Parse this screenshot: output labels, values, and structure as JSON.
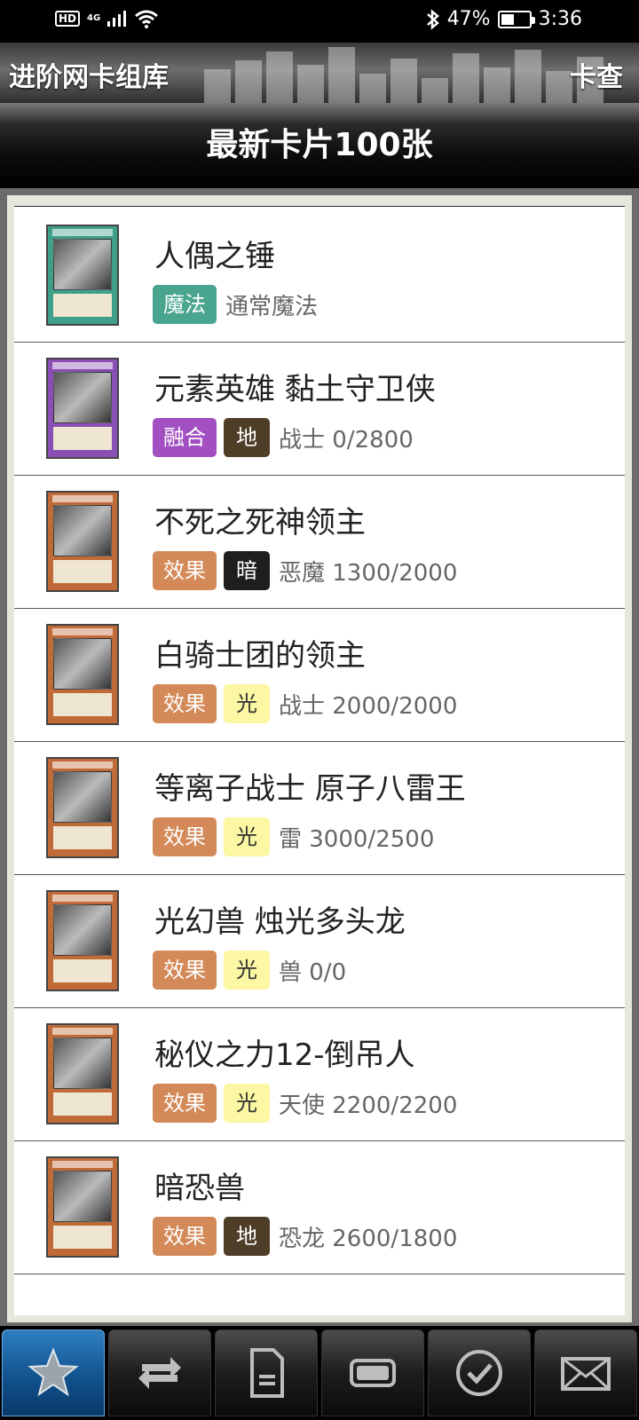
{
  "status_bar": {
    "hd": "HD",
    "network": "4G",
    "battery_percent": "47%",
    "battery_level": 0.47,
    "time": "3:36"
  },
  "header": {
    "title": "进阶网卡组库",
    "action_label": "卡查"
  },
  "section": {
    "title": "最新卡片100张"
  },
  "colors": {
    "spell": "#4aa58f",
    "fusion": "#a14fc1",
    "effect": "#d38a58",
    "attr_earth": "#4e3d27",
    "attr_dark": "#1e1e1e",
    "attr_light": "#fbf7a3",
    "nav_active": "#1f6fb2"
  },
  "cards": [
    {
      "name": "人偶之锤",
      "type": "魔法",
      "type_color": "#4aa58f",
      "attribute": "",
      "attr_bg": "",
      "attr_fg": "",
      "info": "通常魔法",
      "art": "#3fa08a"
    },
    {
      "name": "元素英雄 黏土守卫侠",
      "type": "融合",
      "type_color": "#a14fc1",
      "attribute": "地",
      "attr_bg": "#4e3d27",
      "attr_fg": "#ffffff",
      "info": "战士 0/2800",
      "art": "#8a4fb5"
    },
    {
      "name": "不死之死神领主",
      "type": "效果",
      "type_color": "#d38a58",
      "attribute": "暗",
      "attr_bg": "#1e1e1e",
      "attr_fg": "#ffffff",
      "info": "恶魔 1300/2000",
      "art": "#c06a38"
    },
    {
      "name": "白骑士团的领主",
      "type": "效果",
      "type_color": "#d38a58",
      "attribute": "光",
      "attr_bg": "#fbf7a3",
      "attr_fg": "#333333",
      "info": "战士 2000/2000",
      "art": "#c06a38"
    },
    {
      "name": "等离子战士 原子八雷王",
      "type": "效果",
      "type_color": "#d38a58",
      "attribute": "光",
      "attr_bg": "#fbf7a3",
      "attr_fg": "#333333",
      "info": "雷 3000/2500",
      "art": "#c06a38"
    },
    {
      "name": "光幻兽 烛光多头龙",
      "type": "效果",
      "type_color": "#d38a58",
      "attribute": "光",
      "attr_bg": "#fbf7a3",
      "attr_fg": "#333333",
      "info": "兽 0/0",
      "art": "#c06a38"
    },
    {
      "name": "秘仪之力12-倒吊人",
      "type": "效果",
      "type_color": "#d38a58",
      "attribute": "光",
      "attr_bg": "#fbf7a3",
      "attr_fg": "#333333",
      "info": "天使 2200/2200",
      "art": "#c06a38"
    },
    {
      "name": "暗恐兽",
      "type": "效果",
      "type_color": "#d38a58",
      "attribute": "地",
      "attr_bg": "#4e3d27",
      "attr_fg": "#ffffff",
      "info": "恐龙 2600/1800",
      "art": "#c06a38"
    }
  ],
  "bottom_nav": [
    {
      "icon": "star-icon",
      "active": true
    },
    {
      "icon": "refresh-icon",
      "active": false
    },
    {
      "icon": "document-icon",
      "active": false
    },
    {
      "icon": "card-icon",
      "active": false
    },
    {
      "icon": "check-circle-icon",
      "active": false
    },
    {
      "icon": "mail-icon",
      "active": false
    }
  ]
}
